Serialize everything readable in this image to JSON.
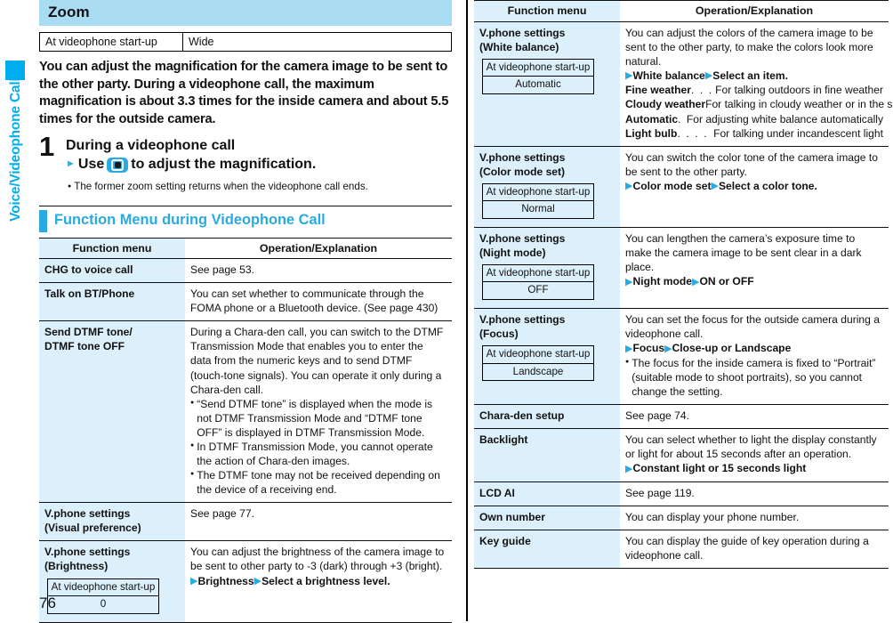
{
  "side_tab": {
    "label": "Voice/Videophone Calls",
    "color": "#00aeef"
  },
  "page_number": "76",
  "left_column": {
    "section_heading": "Zoom",
    "spec_table": {
      "key": "At videophone start-up",
      "value": "Wide"
    },
    "lead_text": "You can adjust the magnification for the camera image to be sent to the other party. During a videophone call, the maximum magnification is about 3.3 times for the inside camera and about 5.5 times for the outside camera.",
    "step": {
      "number": "1",
      "line1": "During a videophone call",
      "line2_prefix": "Use",
      "line2_icon": "navigation-key-icon",
      "line2_suffix": "to adjust the magnification.",
      "note": "The former zoom setting returns when the videophone call ends."
    },
    "cyan_heading": "Function Menu during Videophone Call",
    "table": {
      "headers": {
        "menu": "Function menu",
        "operation": "Operation/Explanation"
      },
      "rows": [
        {
          "menu": "CHG to voice call",
          "paragraphs": [
            "See page 53."
          ]
        },
        {
          "menu": "Talk on BT/Phone",
          "paragraphs": [
            "You can set whether to communicate through the FOMA phone or a Bluetooth device. (See page 430)"
          ]
        },
        {
          "menu": "Send DTMF tone/ DTMF tone OFF",
          "menu_line1": "Send DTMF tone/",
          "menu_line2": "DTMF tone OFF",
          "paragraphs": [
            "During a Chara-den call, you can switch to the DTMF Transmission Mode that enables you to enter the data from the numeric keys and to send DTMF (touch-tone signals). You can operate it only during a Chara-den call."
          ],
          "bullets": [
            "“Send DTMF tone” is displayed when the mode is not DTMF Transmission Mode and “DTMF tone OFF” is displayed in DTMF Transmission Mode.",
            "In DTMF Transmission Mode, you cannot operate the action of Chara-den images.",
            "The DTMF tone may not be received depending on the device of a receiving end."
          ]
        },
        {
          "menu_line1": "V.phone settings",
          "menu_line2": "(Visual preference)",
          "paragraphs": [
            "See page 77."
          ]
        },
        {
          "menu_line1": "V.phone settings",
          "menu_line2": "(Brightness)",
          "mini_table": {
            "label": "At videophone start-up",
            "value": "0"
          },
          "paragraphs": [
            "You can adjust the brightness of the camera image to be sent to other party to -3 (dark) through +3 (bright)."
          ],
          "steps": [
            {
              "a": "Brightness",
              "b": "Select a brightness level."
            }
          ]
        }
      ]
    }
  },
  "right_column": {
    "table": {
      "headers": {
        "menu": "Function menu",
        "operation": "Operation/Explanation"
      },
      "rows": [
        {
          "menu_line1": "V.phone settings",
          "menu_line2": "(White balance)",
          "mini_table": {
            "label": "At videophone start-up",
            "value": "Automatic"
          },
          "paragraphs": [
            "You can adjust the colors of the camera image to be sent to the other party, to make the colors look more natural."
          ],
          "steps": [
            {
              "a": "White balance",
              "b": "Select an item."
            }
          ],
          "definitions": [
            {
              "term": "Fine weather",
              "leader": ". . . . .",
              "desc": "For talking outdoors in fine weather"
            },
            {
              "term": "Cloudy weather",
              "leader": ". . .",
              "desc": "For talking in cloudy weather or in the shade"
            },
            {
              "term": "Automatic",
              "leader": ". . . . . . . .",
              "desc": "For adjusting white balance automatically"
            },
            {
              "term": "Light bulb",
              "leader": ". . . . . . . .",
              "desc": "For talking under incandescent light"
            }
          ]
        },
        {
          "menu_line1": "V.phone settings",
          "menu_line2": "(Color mode set)",
          "mini_table": {
            "label": "At videophone start-up",
            "value": "Normal"
          },
          "paragraphs": [
            "You can switch the color tone of the camera image to be sent to the other party."
          ],
          "steps": [
            {
              "a": "Color mode set",
              "b": "Select a color tone."
            }
          ]
        },
        {
          "menu_line1": "V.phone settings",
          "menu_line2": "(Night mode)",
          "mini_table": {
            "label": "At videophone start-up",
            "value": "OFF"
          },
          "paragraphs": [
            "You can lengthen the camera’s exposure time to make the camera image to be sent clear in a dark place."
          ],
          "steps": [
            {
              "a": "Night mode",
              "b": "ON or OFF"
            }
          ]
        },
        {
          "menu_line1": "V.phone settings",
          "menu_line2": "(Focus)",
          "mini_table": {
            "label": "At videophone start-up",
            "value": "Landscape"
          },
          "paragraphs": [
            "You can set the focus for the outside camera during a videophone call."
          ],
          "steps": [
            {
              "a": "Focus",
              "b": "Close-up or Landscape"
            }
          ],
          "bullets": [
            "The focus for the inside camera is fixed to “Portrait” (suitable mode to shoot portraits), so you cannot change the setting."
          ]
        },
        {
          "menu": "Chara-den setup",
          "paragraphs": [
            "See page 74."
          ]
        },
        {
          "menu": "Backlight",
          "paragraphs": [
            "You can select whether to light the display constantly or light for about 15 seconds after an operation."
          ],
          "steps": [
            {
              "a": "Constant light or 15 seconds light",
              "b": ""
            }
          ]
        },
        {
          "menu": "LCD AI",
          "paragraphs": [
            "See page 119."
          ]
        },
        {
          "menu": "Own number",
          "paragraphs": [
            "You can display your phone number."
          ]
        },
        {
          "menu": "Key guide",
          "paragraphs": [
            "You can display the guide of key operation during a videophone call."
          ]
        }
      ]
    }
  }
}
